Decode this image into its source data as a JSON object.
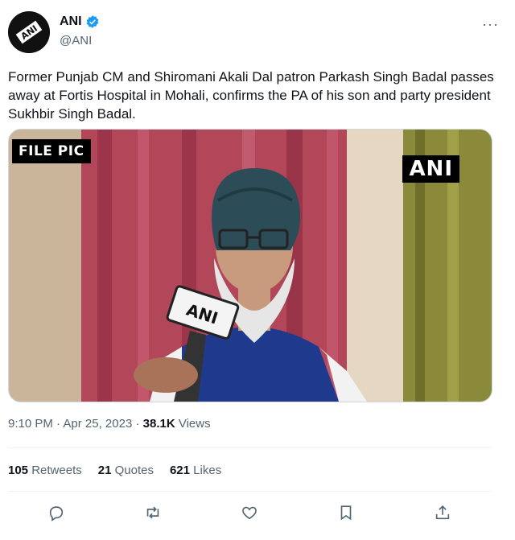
{
  "account": {
    "display_name": "ANI",
    "handle": "@ANI",
    "avatar_text": "ANI",
    "verified": true
  },
  "more_label": "···",
  "tweet_text": "Former Punjab CM and Shiromani Akali Dal patron Parkash Singh Badal passes away at Fortis Hospital in Mohali, confirms the PA of his son and party president Sukhbir Singh Badal.",
  "media": {
    "overlay_label": "FILE PIC",
    "watermark": "ANI",
    "mic_text": "ANI"
  },
  "meta": {
    "time": "9:10 PM",
    "separator": "·",
    "date": "Apr 25, 2023",
    "views_count": "38.1K",
    "views_label": "Views"
  },
  "stats": {
    "retweets_count": "105",
    "retweets_label": "Retweets",
    "quotes_count": "21",
    "quotes_label": "Quotes",
    "likes_count": "621",
    "likes_label": "Likes"
  },
  "actions": [
    {
      "icon": "reply-icon"
    },
    {
      "icon": "retweet-icon"
    },
    {
      "icon": "like-icon"
    },
    {
      "icon": "bookmark-icon"
    },
    {
      "icon": "share-icon"
    }
  ],
  "colors": {
    "text": "#0f1419",
    "secondary": "#536471",
    "verified": "#1d9bf0",
    "divider": "#eff3f4"
  }
}
